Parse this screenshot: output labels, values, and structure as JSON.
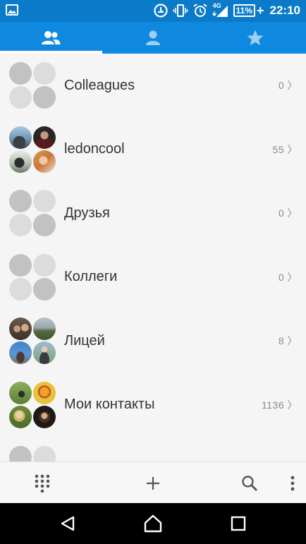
{
  "status_bar": {
    "network": "4G",
    "battery_percent": "11%",
    "time": "22:10",
    "icons": [
      "image-icon",
      "data-saver-icon",
      "vibrate-icon",
      "alarm-icon",
      "signal-icon",
      "battery-icon",
      "charging-icon"
    ]
  },
  "tabs": [
    {
      "name": "groups",
      "icon": "groups-icon",
      "active": true
    },
    {
      "name": "contacts",
      "icon": "person-icon",
      "active": false
    },
    {
      "name": "favorites",
      "icon": "star-icon",
      "active": false
    }
  ],
  "groups": [
    {
      "name": "Colleagues",
      "count": "0 〉"
    },
    {
      "name": "ledoncool",
      "count": "55 〉"
    },
    {
      "name": "Друзья",
      "count": "0 〉"
    },
    {
      "name": "Коллеги",
      "count": "0 〉"
    },
    {
      "name": "Лицей",
      "count": "8 〉"
    },
    {
      "name": "Мои контакты",
      "count": "1136 〉"
    }
  ],
  "action_bar": {
    "icons": [
      "dialpad-icon",
      "add-icon",
      "search-icon",
      "more-icon"
    ]
  },
  "nav_bar": {
    "icons": [
      "back-icon",
      "home-icon",
      "recents-icon"
    ]
  },
  "colors": {
    "status_bar": "#0b7ac9",
    "tab_bar": "#0e89df",
    "background": "#f5f5f5"
  }
}
